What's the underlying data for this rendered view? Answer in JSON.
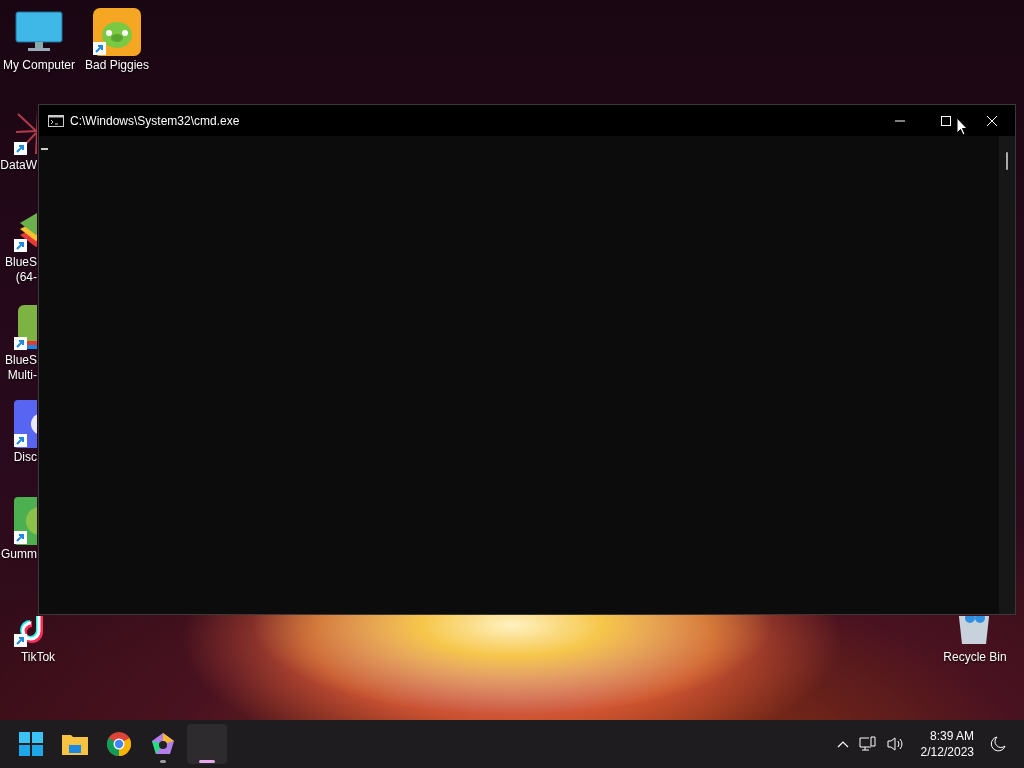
{
  "desktop_icons": [
    {
      "kind": "computer",
      "label_lines": [
        "My Computer"
      ]
    },
    {
      "kind": "piggies",
      "label_lines": [
        "Bad Piggies"
      ]
    },
    {
      "kind": "dataw",
      "label_lines": [
        "DataW"
      ]
    },
    {
      "kind": "bluestacks",
      "label_lines": [
        "BlueS",
        "(64-"
      ]
    },
    {
      "kind": "bluestacks-multi",
      "label_lines": [
        "BlueS",
        "Multi-"
      ]
    },
    {
      "kind": "discord",
      "label_lines": [
        "Disc"
      ]
    },
    {
      "kind": "gummy",
      "label_lines": [
        "Gumm"
      ]
    },
    {
      "kind": "tiktok",
      "label_lines": [
        "TikTok"
      ]
    },
    {
      "kind": "recycle",
      "label_lines": [
        "Recycle Bin"
      ]
    }
  ],
  "window": {
    "title": "C:\\Windows\\System32\\cmd.exe"
  },
  "taskbar": {
    "apps": [
      {
        "kind": "start",
        "running": false,
        "selected": false
      },
      {
        "kind": "explorer",
        "running": false,
        "selected": false
      },
      {
        "kind": "chrome",
        "running": false,
        "selected": false
      },
      {
        "kind": "pentagon",
        "running": true,
        "selected": false
      },
      {
        "kind": "terminal",
        "running": true,
        "selected": true
      }
    ],
    "time": "8:39 AM",
    "date": "2/12/2023"
  }
}
